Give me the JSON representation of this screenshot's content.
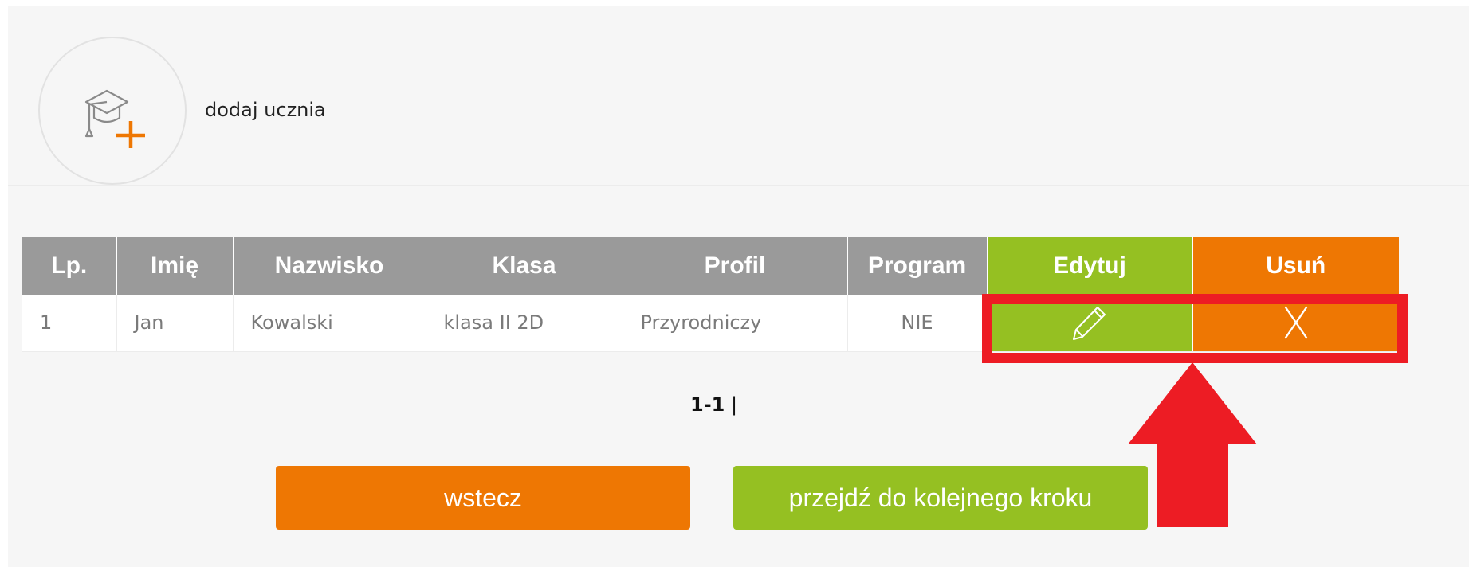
{
  "add_student": {
    "label": "dodaj ucznia",
    "icon": "graduation-cap-plus-icon"
  },
  "table": {
    "headers": {
      "lp": "Lp.",
      "imie": "Imię",
      "nazwisko": "Nazwisko",
      "klasa": "Klasa",
      "profil": "Profil",
      "program": "Program",
      "edytuj": "Edytuj",
      "usun": "Usuń"
    },
    "rows": [
      {
        "lp": "1",
        "imie": "Jan",
        "nazwisko": "Kowalski",
        "klasa": "klasa II 2D",
        "profil": "Przyrodniczy",
        "program": "NIE",
        "edit_icon": "pencil-icon",
        "delete_icon": "close-x-icon",
        "delete_symbol": "X"
      }
    ]
  },
  "pagination": {
    "range": "1-1",
    "separator": "|"
  },
  "buttons": {
    "back": "wstecz",
    "next": "przejdź do kolejnego kroku"
  },
  "colors": {
    "green": "#95c022",
    "orange": "#ee7703",
    "header_gray": "#9a9a9a",
    "annotation_red": "#ed1c24"
  }
}
